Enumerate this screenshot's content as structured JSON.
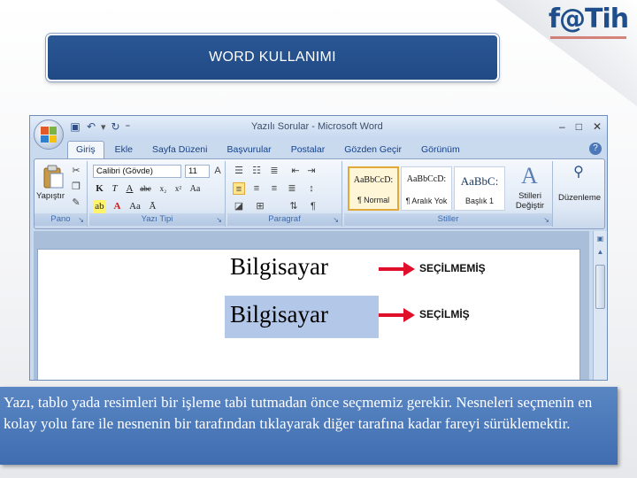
{
  "slide": {
    "title": "WORD KULLANIMI",
    "logo_text": "f@Tih",
    "caption": "Yazı, tablo yada resimleri bir işleme tabi tutmadan önce seçmemiz gerekir. Nesneleri seçmenin en kolay yolu fare ile nesnenin bir tarafından tıklayarak diğer tarafına kadar fareyi sürüklemektir."
  },
  "window": {
    "title": "Yazılı Sorular - Microsoft Word"
  },
  "tabs": [
    {
      "label": "Giriş"
    },
    {
      "label": "Ekle"
    },
    {
      "label": "Sayfa Düzeni"
    },
    {
      "label": "Başvurular"
    },
    {
      "label": "Postalar"
    },
    {
      "label": "Gözden Geçir"
    },
    {
      "label": "Görünüm"
    }
  ],
  "ribbon": {
    "clipboard": {
      "label": "Pano",
      "paste_label": "Yapıştır"
    },
    "font": {
      "label": "Yazı Tipi",
      "font_name": "Calibri (Gövde)",
      "font_size": "11"
    },
    "paragraph": {
      "label": "Paragraf"
    },
    "styles": {
      "label": "Stiller",
      "items": [
        {
          "sample": "AaBbCcD:",
          "name": "¶ Normal"
        },
        {
          "sample": "AaBbCcD:",
          "name": "¶ Aralık Yok"
        },
        {
          "sample": "AaBbC:",
          "name": "Başlık 1"
        }
      ],
      "change_label": "Stilleri Değiştir"
    },
    "editing": {
      "label": "Düzenleme"
    }
  },
  "document": {
    "word_plain": "Bilgisayar",
    "word_selected": "Bilgisayar",
    "label_not_selected": "SEÇİLMEMİŞ",
    "label_selected": "SEÇİLMİŞ"
  },
  "colors": {
    "title_bar": "#1f4a84",
    "caption_bg": "#4a78b8",
    "arrow": "#e0102a",
    "selection": "#b3c8e8"
  }
}
